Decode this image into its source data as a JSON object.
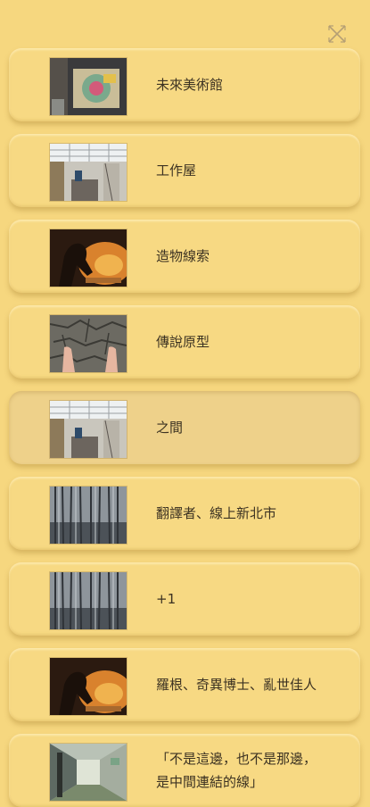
{
  "close_icon": "close-icon",
  "colors": {
    "background": "#f6d77f",
    "card": "#f7d983",
    "text": "#3c3222"
  },
  "items": [
    {
      "label": "未來美術館",
      "thumb": "gallery-wall"
    },
    {
      "label": "工作屋",
      "thumb": "workshop"
    },
    {
      "label": "造物線索",
      "thumb": "figure-fire"
    },
    {
      "label": "傳說原型",
      "thumb": "feet-cracked-earth"
    },
    {
      "label": "之間",
      "thumb": "workshop"
    },
    {
      "label": "翻譯者、線上新北市",
      "thumb": "forest"
    },
    {
      "label": "+1",
      "thumb": "forest"
    },
    {
      "label": "羅根、奇異博士、亂世佳人",
      "thumb": "figure-fire"
    },
    {
      "label": "「不是這邊，也不是那邊，\n是中間連結的線」",
      "thumb": "corridor"
    }
  ]
}
